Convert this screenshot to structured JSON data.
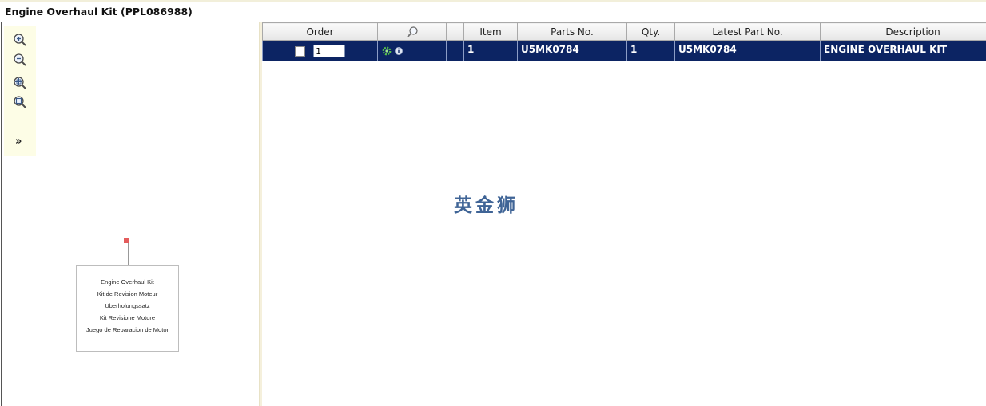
{
  "page": {
    "title": "Engine Overhaul Kit (PPL086988)"
  },
  "left_panel": {
    "tools": [
      {
        "icon": "zoom-in-icon"
      },
      {
        "icon": "zoom-out-icon"
      },
      {
        "icon": "zoom-region-icon"
      },
      {
        "icon": "zoom-fit-icon"
      }
    ],
    "expand_label": "»",
    "diagram": {
      "lines": [
        "Engine Overhaul Kit",
        "Kit de Revision Moteur",
        "Uberholungssatz",
        "Kit Revisione Motore",
        "Juego de Reparacion de Motor"
      ]
    }
  },
  "table": {
    "headers": {
      "order": "Order",
      "item": "Item",
      "parts_no": "Parts No.",
      "qty": "Qty.",
      "latest_part_no": "Latest Part No.",
      "description": "Description"
    },
    "rows": [
      {
        "checked": false,
        "order_qty": "1",
        "item": "1",
        "parts_no": "U5MK0784",
        "qty": "1",
        "latest_part_no": "U5MK0784",
        "description": "ENGINE OVERHAUL KIT"
      }
    ]
  },
  "watermark": "英金狮",
  "colors": {
    "selected_row": "#0c2463",
    "toolbar_bg": "#fdfde6",
    "splitter": "#f5f0dc"
  }
}
